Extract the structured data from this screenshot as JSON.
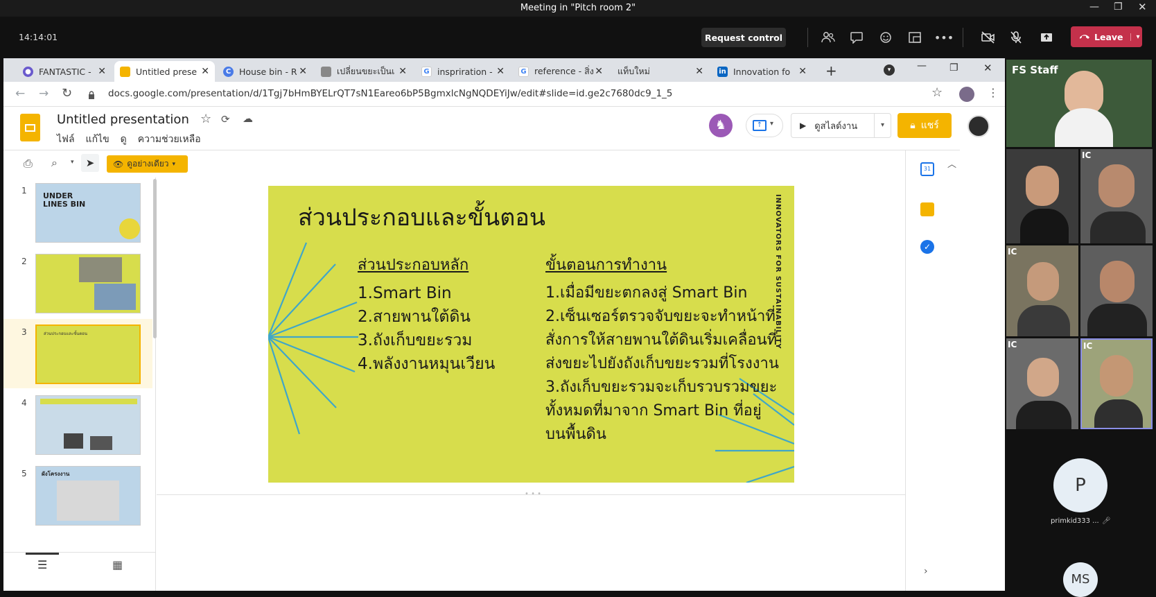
{
  "meeting": {
    "window_title": "Meeting in \"Pitch room 2\"",
    "timer": "14:14:01",
    "request_control": "Request control",
    "leave": "Leave",
    "accent": "#c4314b"
  },
  "browser": {
    "tabs": [
      {
        "label": "FANTASTIC -",
        "icon": "globe-icon"
      },
      {
        "label": "Untitled prese",
        "icon": "slides-icon"
      },
      {
        "label": "House bin - R",
        "icon": "c-icon"
      },
      {
        "label": "เปลี่ยนขยะเป็นเ",
        "icon": "page-icon"
      },
      {
        "label": "inspriration -",
        "icon": "google-icon"
      },
      {
        "label": "reference - สิ่ง",
        "icon": "google-icon"
      },
      {
        "label": "แท็บใหม่",
        "icon": "none"
      },
      {
        "label": "Innovation fo",
        "icon": "linkedin-icon"
      }
    ],
    "url": "docs.google.com/presentation/d/1Tgj7bHmBYELrQT7sN1Eareo6bP5BgmxlcNgNQDEYiJw/edit#slide=id.ge2c7680dc9_1_5"
  },
  "slides": {
    "doc_title": "Untitled presentation",
    "menu": [
      "ไฟล์",
      "แก้ไข",
      "ดู",
      "ความช่วยเหลือ"
    ],
    "present_label": "ดูสไลด์งาน",
    "share_label": "แชร์",
    "view_mode": "ดูอย่างเดียว",
    "thumbnails": [
      {
        "num": "1",
        "title": "UNDER LINES BIN"
      },
      {
        "num": "2",
        "title": ""
      },
      {
        "num": "3",
        "title": "ส่วนประกอบและขั้นตอน"
      },
      {
        "num": "4",
        "title": ""
      },
      {
        "num": "5",
        "title": "ผังโครงงาน"
      }
    ],
    "current": {
      "title": "ส่วนประกอบและขั้นตอน",
      "side_text": "INNOVATORS FOR SUSTAINABILITY",
      "left_heading": "ส่วนประกอบหลัก",
      "left_items": [
        "1.Smart Bin",
        "2.สายพานใต้ดิน",
        "3.ถังเก็บขยะรวม",
        "4.พลังงานหมุนเวียน"
      ],
      "right_heading": "ขั้นตอนการทำงาน",
      "right_lines": [
        "1.เมื่อมีขยะตกลงสู่ Smart Bin",
        "2.เซ็นเซอร์ตรวจจับขยะจะทำหน้าที่",
        "สั่งการให้สายพานใต้ดินเริ่มเคลื่อนที่",
        "ส่งขยะไปยังถังเก็บขยะรวมที่โรงงาน",
        "3.ถังเก็บขยะรวมจะเก็บรวบรวมขยะ",
        "ทั้งหมดที่มาจาก Smart Bin ที่อยู่",
        "บนพื้นดิน"
      ],
      "bg_color": "#d7dd4c",
      "line_color": "#3fa6c9"
    }
  },
  "participants": {
    "top_tile_label": "FS Staff",
    "avatar_letter": "P",
    "avatar_name": "primkid333 ...",
    "avatar2_letter": "MS",
    "tile_badge": "IC"
  }
}
